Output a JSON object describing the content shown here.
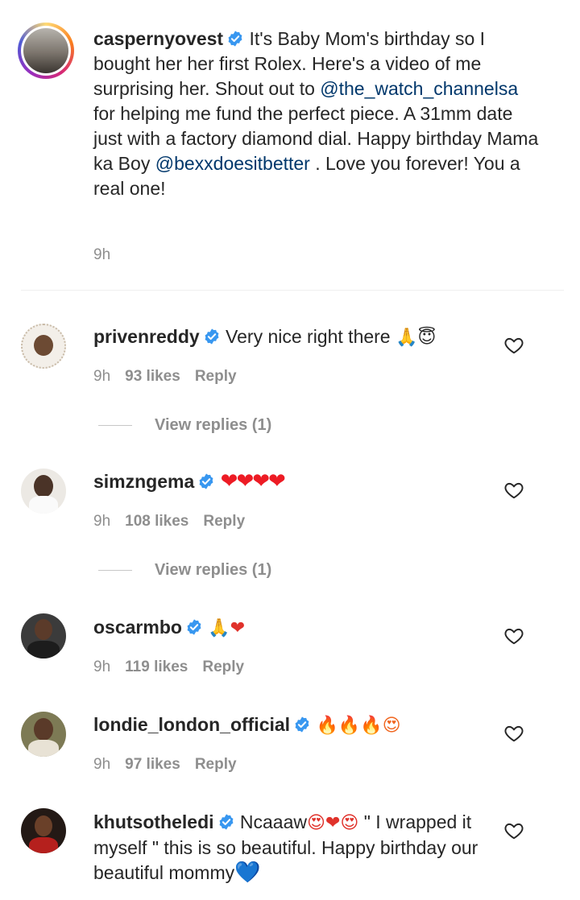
{
  "caption": {
    "username": "caspernyovest",
    "text_1": "It's Baby Mom's birthday so I bought her her first Rolex. Here's a video of me surprising her. Shout out to ",
    "mention_1": "@the_watch_channelsa",
    "text_2": " for helping me fund the perfect piece. A 31mm date just with a factory diamond dial. Happy birthday Mama ka Boy ",
    "mention_2": "@bexxdoesitbetter",
    "text_3": " . Love you forever! You a real one!",
    "time": "9h"
  },
  "comments": [
    {
      "username": "privenreddy",
      "text": "Very nice right there",
      "emojis": "🙏😇",
      "time": "9h",
      "likes": "93 likes",
      "reply": "Reply",
      "view_replies": "View replies (1)"
    },
    {
      "username": "simzngema",
      "text": "",
      "emojis": "❤❤❤❤",
      "time": "9h",
      "likes": "108 likes",
      "reply": "Reply",
      "view_replies": "View replies (1)"
    },
    {
      "username": "oscarmbo",
      "text": "",
      "emojis": "🙏❤",
      "time": "9h",
      "likes": "119 likes",
      "reply": "Reply"
    },
    {
      "username": "londie_london_official",
      "text": "",
      "emojis": "🔥🔥🔥😍",
      "time": "9h",
      "likes": "97 likes",
      "reply": "Reply"
    },
    {
      "username": "khutsotheledi",
      "text_1": "Ncaaaw",
      "emojis_1": "😍❤😍",
      "text_2": " \" I wrapped it myself \" this is so beautiful. Happy birthday our beautiful mommy",
      "emojis_2": "💙"
    }
  ],
  "icons": {
    "verified": "verified-badge-icon",
    "like": "heart-outline-icon"
  },
  "colors": {
    "verified_blue": "#3897f0",
    "link": "#00376b",
    "muted": "#8e8e8e"
  }
}
